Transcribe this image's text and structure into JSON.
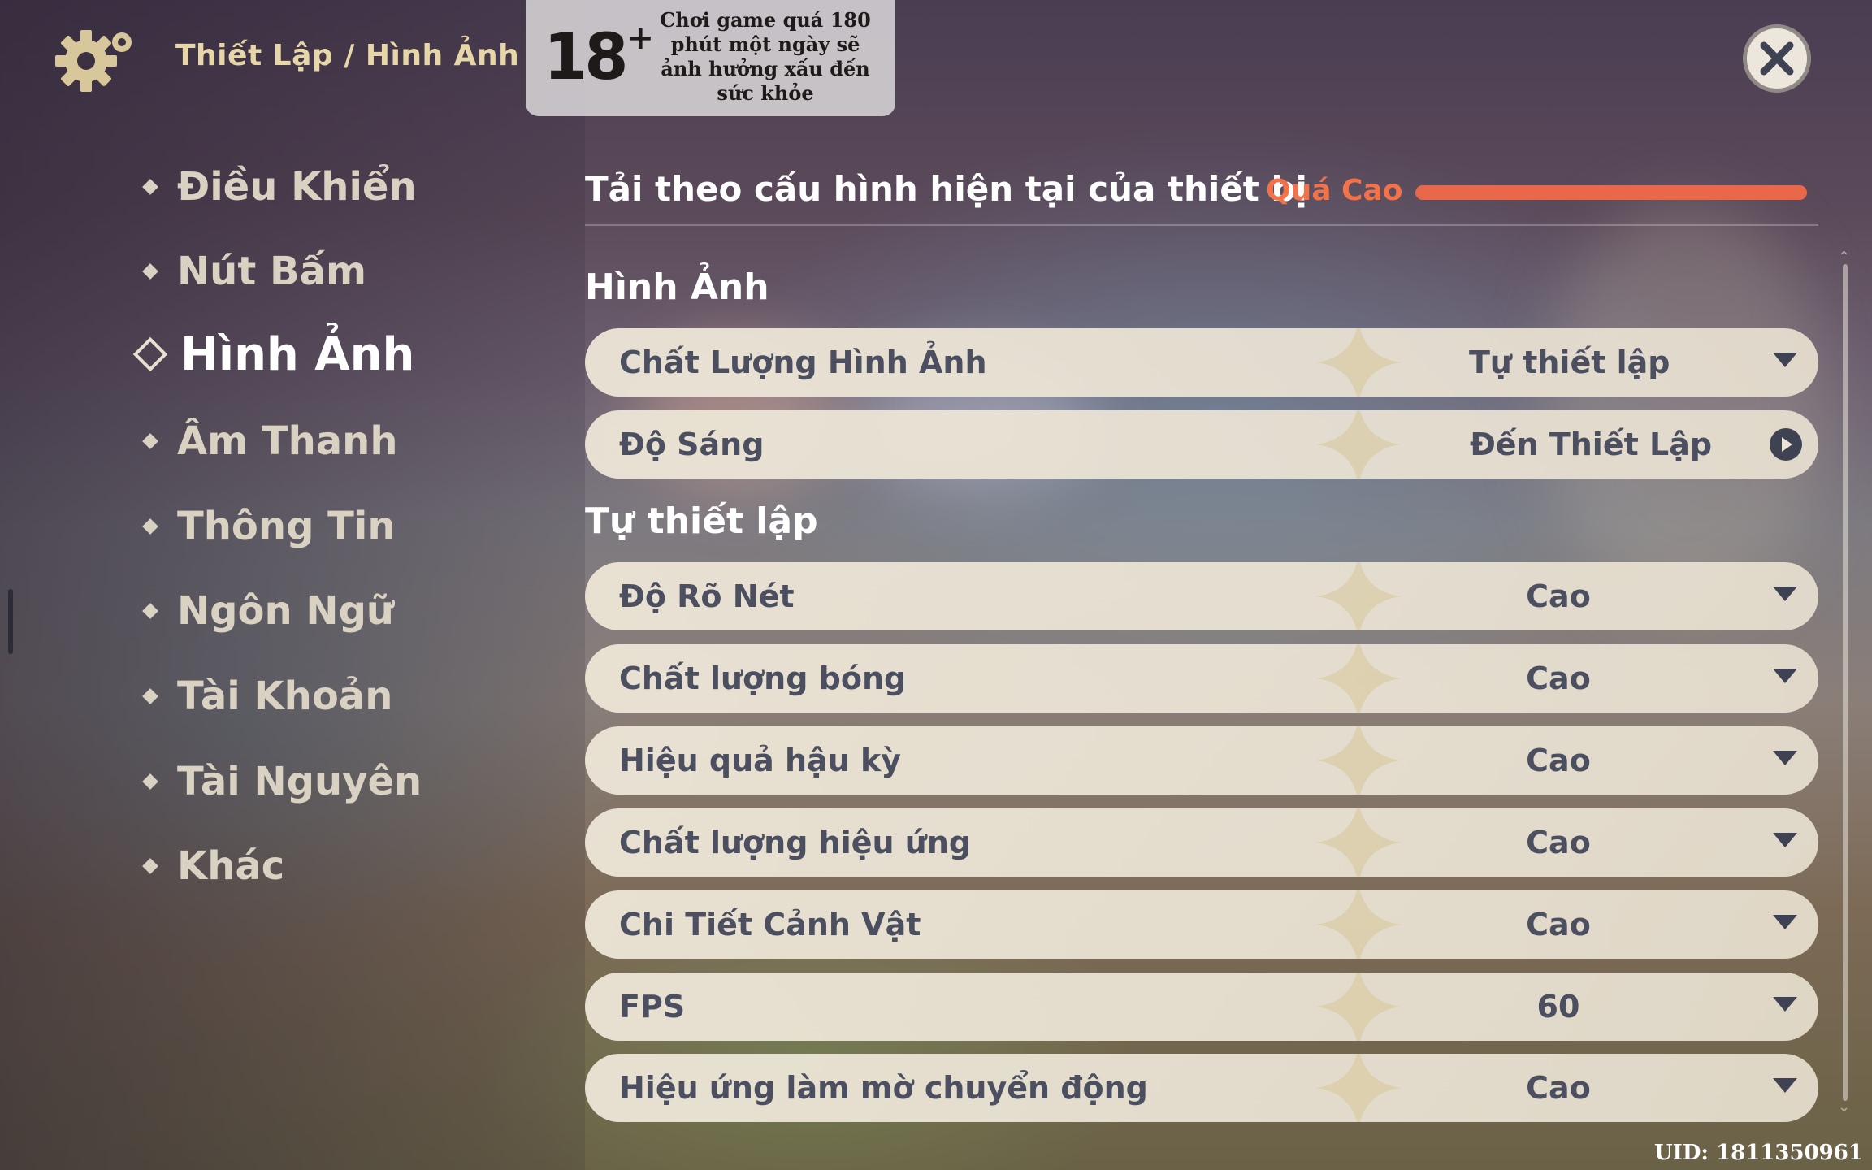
{
  "header": {
    "breadcrumb": "Thiết Lập / Hình Ảnh",
    "age_rating": "18",
    "age_plus": "+",
    "age_warning": "Chơi game quá 180 phút một ngày sẽ ảnh hưởng xấu  đến sức khỏe",
    "close_icon": "close-icon"
  },
  "sidebar": {
    "items": [
      {
        "label": "Điều Khiển"
      },
      {
        "label": "Nút Bấm"
      },
      {
        "label": "Hình Ảnh",
        "active": true
      },
      {
        "label": "Âm Thanh"
      },
      {
        "label": "Thông Tin"
      },
      {
        "label": "Ngôn Ngữ"
      },
      {
        "label": "Tài Khoản"
      },
      {
        "label": "Tài Nguyên"
      },
      {
        "label": "Khác"
      }
    ]
  },
  "load": {
    "label": "Tải theo cấu hình hiện tại của thiết bị",
    "value": "Quá Cao",
    "color": "#e9684a"
  },
  "sections": {
    "graphics_title": "Hình Ảnh",
    "custom_title": "Tự thiết lập"
  },
  "settings": {
    "graphics": [
      {
        "label": "Chất Lượng Hình Ảnh",
        "value": "Tự thiết lập",
        "control": "dropdown"
      },
      {
        "label": "Độ Sáng",
        "value": "Đến Thiết Lập",
        "control": "link"
      }
    ],
    "custom": [
      {
        "label": "Độ Rõ Nét",
        "value": "Cao"
      },
      {
        "label": "Chất lượng bóng",
        "value": "Cao"
      },
      {
        "label": "Hiệu quả hậu kỳ",
        "value": "Cao"
      },
      {
        "label": "Chất lượng hiệu ứng",
        "value": "Cao"
      },
      {
        "label": "Chi Tiết Cảnh Vật",
        "value": "Cao"
      },
      {
        "label": "FPS",
        "value": "60"
      },
      {
        "label": "Hiệu ứng làm mờ chuyển động",
        "value": "Cao"
      }
    ]
  },
  "footer": {
    "uid": "UID: 1811350961"
  }
}
